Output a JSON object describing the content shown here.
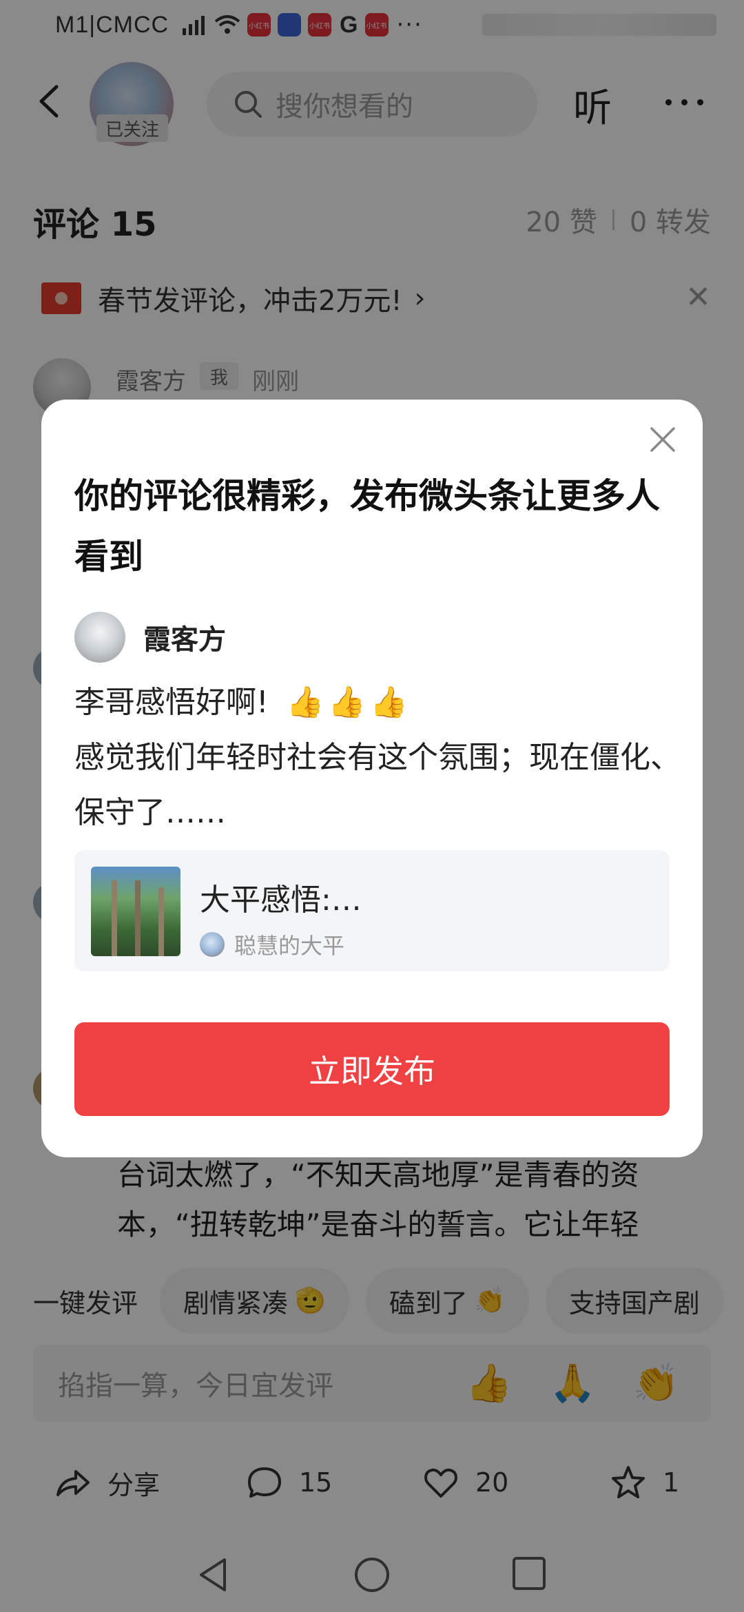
{
  "status_bar": {
    "carrier": "M1|CMCC",
    "app_badge_label": "小红书",
    "extra_glyph": "G",
    "more": "···"
  },
  "header": {
    "followed_tag": "已关注",
    "search_placeholder": "搜你想看的",
    "listen_label": "听"
  },
  "comments_header": {
    "title": "评论 15",
    "likes": "20 赞",
    "reposts": "0 转发"
  },
  "banner": {
    "text": "春节发评论，冲击2万元!",
    "chevron": "›",
    "close": "✕"
  },
  "my_comment": {
    "username": "霞客方",
    "me_tag": "我",
    "time": "刚刚"
  },
  "background_text": "台词太燃了，“不知天高地厚”是青春的资本，“扭转乾坤”是奋斗的誓言。它让年轻",
  "quick_reply": {
    "lead": "一键发评",
    "chips": [
      {
        "label": "剧情紧凑",
        "emoji": "🫡"
      },
      {
        "label": "磕到了",
        "emoji": "👏"
      },
      {
        "label": "支持国产剧",
        "emoji": ""
      }
    ]
  },
  "input": {
    "placeholder": "掐指一算，今日宜发评",
    "emojis": [
      "👍",
      "🙏",
      "👏"
    ]
  },
  "action_bar": {
    "share": "分享",
    "comments": "15",
    "likes": "20",
    "favorites": "1"
  },
  "dialog": {
    "title": "你的评论很精彩，发布微头条让更多人看到",
    "username": "霞客方",
    "comment_line1": "李哥感悟好啊!",
    "thumbs": "👍👍👍",
    "comment_line2": "感觉我们年轻时社会有这个氛围；现在僵化、保守了……",
    "card_title": "大平感悟:…",
    "card_author": "聪慧的大平",
    "publish_label": "立即发布"
  },
  "colors": {
    "accent": "#f04142",
    "overlay": "rgba(0,0,0,0.46)",
    "banner_envelope": "#e53b2e"
  }
}
